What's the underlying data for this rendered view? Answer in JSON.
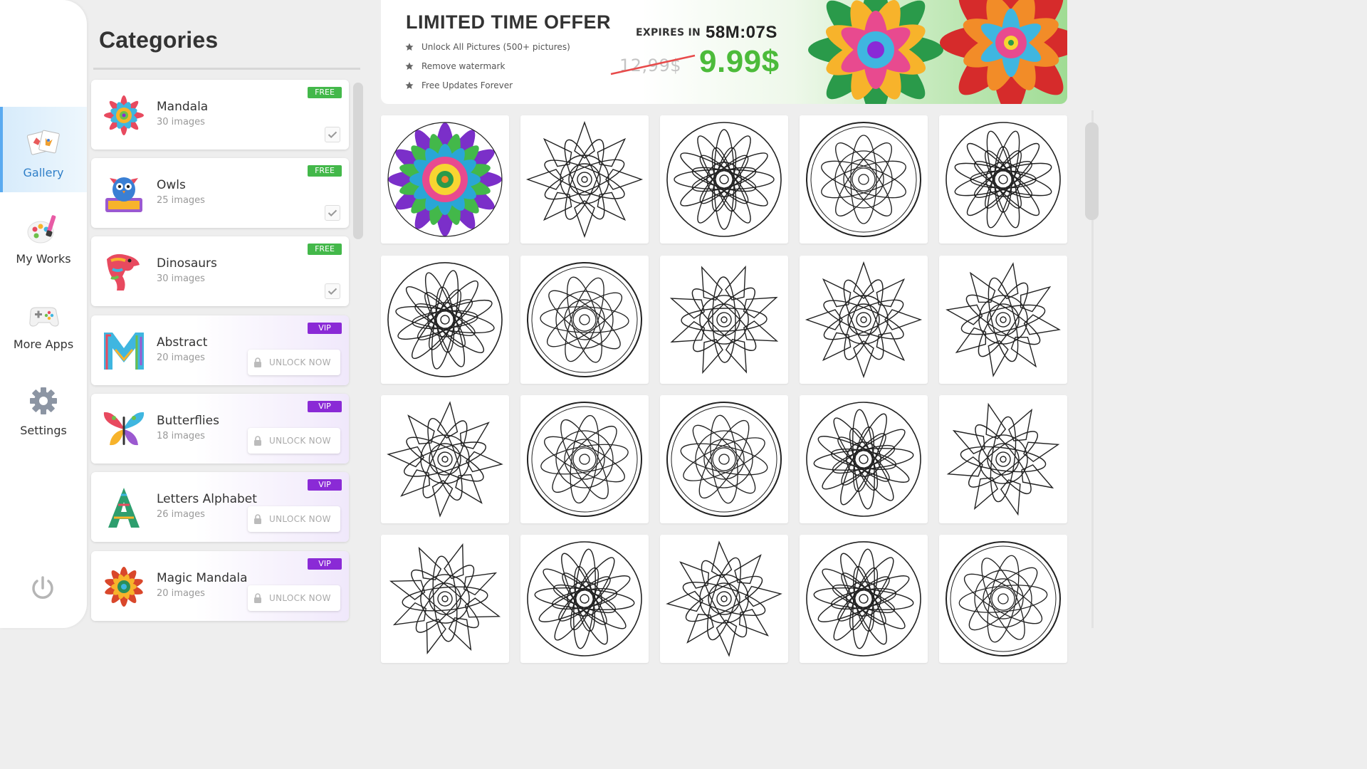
{
  "nav": {
    "items": [
      {
        "label": "Gallery",
        "icon": "gallery-icon",
        "active": true
      },
      {
        "label": "My Works",
        "icon": "palette-icon",
        "active": false
      },
      {
        "label": "More Apps",
        "icon": "gamepad-icon",
        "active": false
      },
      {
        "label": "Settings",
        "icon": "gear-icon",
        "active": false
      }
    ],
    "power_icon": "power-icon"
  },
  "categories": {
    "title": "Categories",
    "items": [
      {
        "name": "Mandala",
        "count": "30 images",
        "badge": "FREE",
        "type": "free"
      },
      {
        "name": "Owls",
        "count": "25 images",
        "badge": "FREE",
        "type": "free"
      },
      {
        "name": "Dinosaurs",
        "count": "30 images",
        "badge": "FREE",
        "type": "free"
      },
      {
        "name": "Abstract",
        "count": "20 images",
        "badge": "VIP",
        "type": "vip",
        "unlock": "UNLOCK NOW"
      },
      {
        "name": "Butterflies",
        "count": "18 images",
        "badge": "VIP",
        "type": "vip",
        "unlock": "UNLOCK NOW"
      },
      {
        "name": "Letters Alphabet",
        "count": "26 images",
        "badge": "VIP",
        "type": "vip",
        "unlock": "UNLOCK NOW"
      },
      {
        "name": "Magic Mandala",
        "count": "20 images",
        "badge": "VIP",
        "type": "vip",
        "unlock": "UNLOCK NOW"
      }
    ]
  },
  "offer": {
    "title": "LIMITED TIME OFFER",
    "features": [
      "Unlock All Pictures (500+ pictures)",
      "Remove watermark",
      "Free Updates Forever"
    ],
    "expires_label": "EXPIRES IN",
    "expires_time": "58M:07S",
    "old_price": "12,99$",
    "new_price": "9.99$"
  },
  "colors": {
    "free_badge": "#43b84a",
    "vip_badge": "#8a2ad6",
    "price_green": "#4cbb3a",
    "nav_active": "#5aaaf0"
  }
}
